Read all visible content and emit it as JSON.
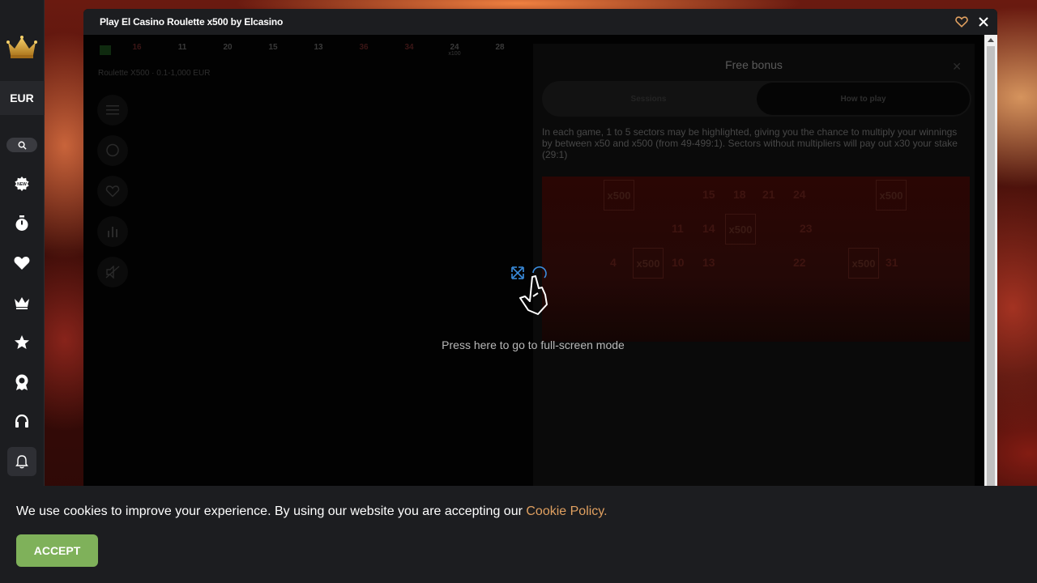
{
  "sidebar": {
    "currency": "EUR",
    "icons": [
      "new-icon",
      "timer-icon",
      "heart-icon",
      "crown-icon",
      "star-icon",
      "medal-icon",
      "headset-icon",
      "bell-icon"
    ]
  },
  "modal": {
    "title": "Play El Casino Roulette x500 by Elcasino"
  },
  "game": {
    "numbers": [
      {
        "label": "16",
        "red": true,
        "sub": ""
      },
      {
        "label": "11",
        "red": false,
        "sub": ""
      },
      {
        "label": "20",
        "red": false,
        "sub": ""
      },
      {
        "label": "15",
        "red": false,
        "sub": ""
      },
      {
        "label": "13",
        "red": false,
        "sub": ""
      },
      {
        "label": "36",
        "red": true,
        "sub": ""
      },
      {
        "label": "34",
        "red": true,
        "sub": ""
      },
      {
        "label": "24",
        "red": false,
        "sub": "x100"
      },
      {
        "label": "28",
        "red": false,
        "sub": ""
      }
    ],
    "subtitle": "Roulette X500 · 0.1-1,000 EUR",
    "panel": {
      "title": "Free bonus",
      "tabs": [
        "Sessions",
        "How to play"
      ],
      "description": "In each game, 1 to 5 sectors may be highlighted, giving you the chance to multiply your winnings by between x50 and x500 (from 49-499:1). Sectors without multipliers will pay out x30 your stake (29:1)"
    },
    "fullscreen_prompt": "Press here to go to full-screen mode"
  },
  "cookie": {
    "text": "We use cookies to improve your experience. By using our website you are accepting our ",
    "link": "Cookie Policy.",
    "accept": "ACCEPT"
  },
  "colors": {
    "accent": "#7fb15a",
    "link": "#e0a060",
    "sidebar_bg": "#1c1d20"
  }
}
